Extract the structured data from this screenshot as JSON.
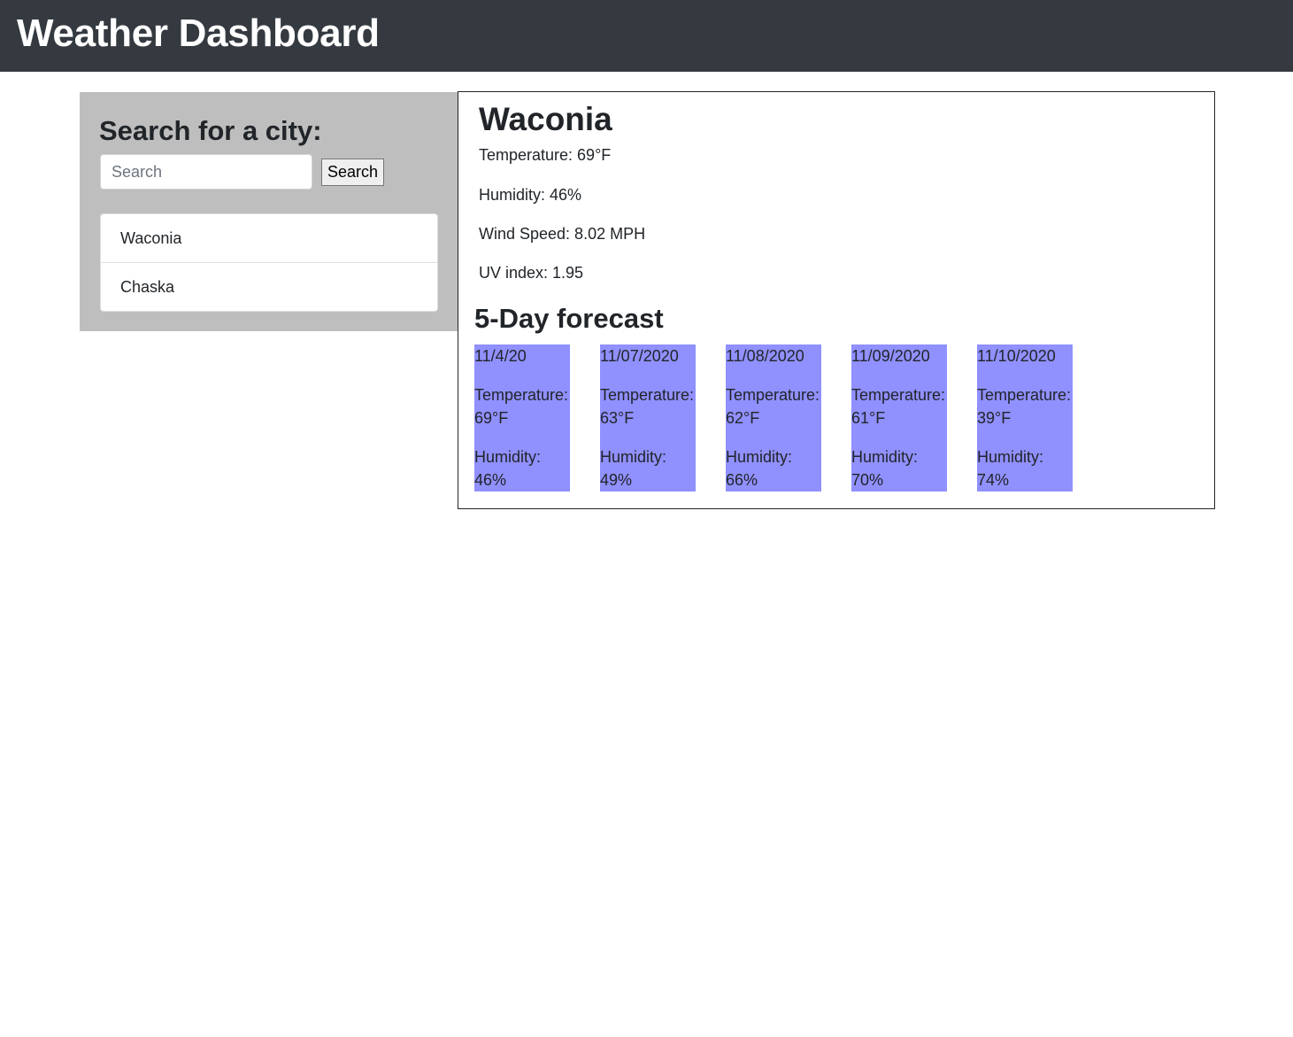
{
  "header": {
    "title": "Weather Dashboard"
  },
  "sidebar": {
    "heading": "Search for a city:",
    "search": {
      "placeholder": "Search",
      "value": ""
    },
    "search_button_label": "Search",
    "cities": [
      "Waconia",
      "Chaska"
    ]
  },
  "current": {
    "city": "Waconia",
    "temperature": "Temperature: 69°F",
    "humidity": "Humidity: 46%",
    "wind": "Wind Speed: 8.02 MPH",
    "uv": "UV index: 1.95"
  },
  "forecast": {
    "title": "5-Day forecast",
    "card_color": "#9090ff",
    "days": [
      {
        "date": "11/4/20",
        "temp": "Temperature: 69°F",
        "humidity": "Humidity: 46%"
      },
      {
        "date": "11/07/2020",
        "temp": "Temperature: 63°F",
        "humidity": "Humidity: 49%"
      },
      {
        "date": "11/08/2020",
        "temp": "Temperature: 62°F",
        "humidity": "Humidity: 66%"
      },
      {
        "date": "11/09/2020",
        "temp": "Temperature: 61°F",
        "humidity": "Humidity: 70%"
      },
      {
        "date": "11/10/2020",
        "temp": "Temperature: 39°F",
        "humidity": "Humidity: 74%"
      }
    ]
  },
  "colors": {
    "navbar": "#343a40",
    "sidebar": "#bebebe"
  }
}
